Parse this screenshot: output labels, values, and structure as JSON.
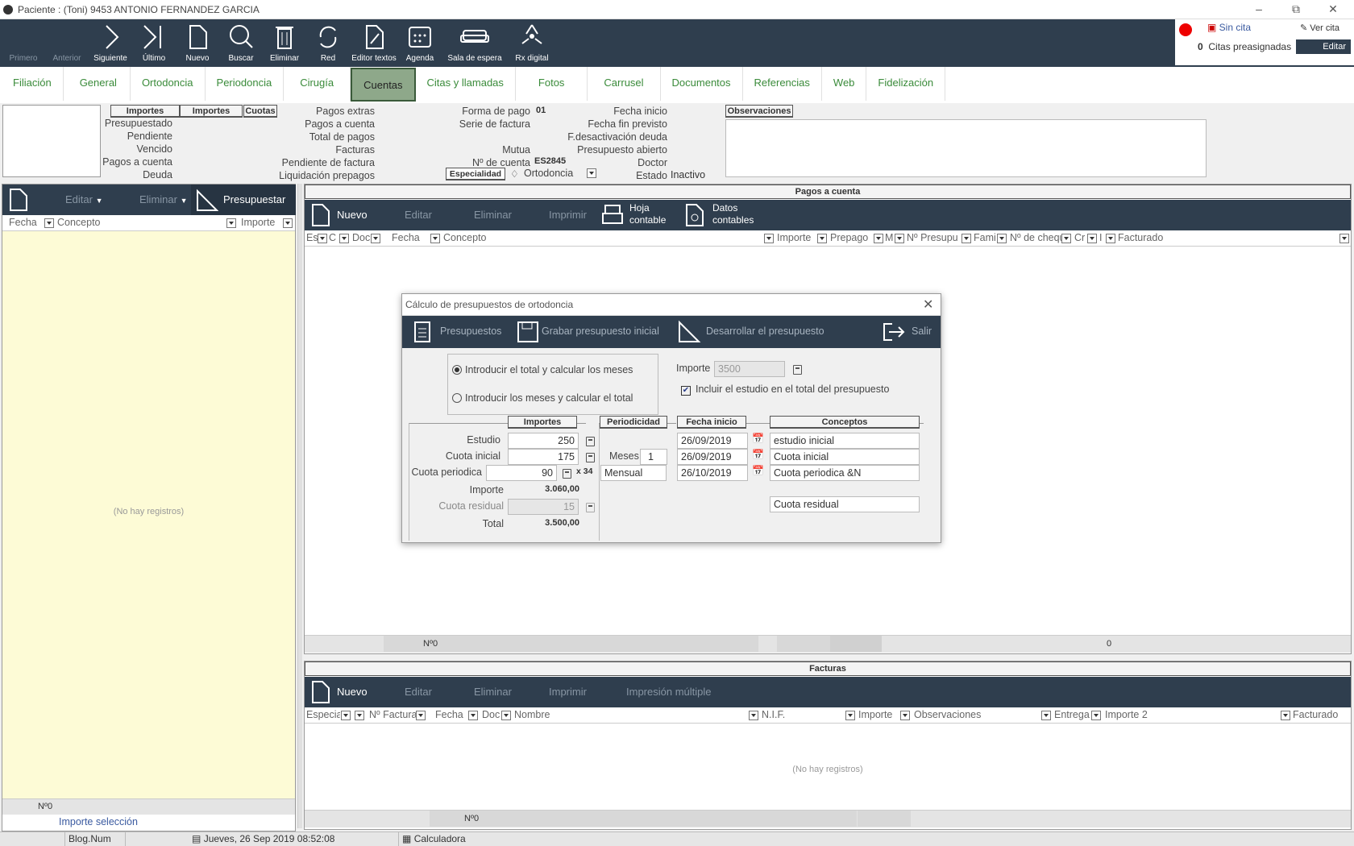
{
  "window": {
    "title": "Paciente :  (Toni)  9453 ANTONIO FERNANDEZ GARCIA"
  },
  "toolbar": [
    {
      "label": "Primero",
      "icon": "first-icon",
      "enabled": false
    },
    {
      "label": "Anterior",
      "icon": "previous-icon",
      "enabled": false
    },
    {
      "label": "Siguiente",
      "icon": "next-icon",
      "enabled": true
    },
    {
      "label": "Último",
      "icon": "last-icon",
      "enabled": true
    },
    {
      "label": "Nuevo",
      "icon": "new-document-icon",
      "enabled": true
    },
    {
      "label": "Buscar",
      "icon": "search-icon",
      "enabled": true
    },
    {
      "label": "Eliminar",
      "icon": "trash-icon",
      "enabled": true
    },
    {
      "label": "Red",
      "icon": "refresh-icon",
      "enabled": true
    },
    {
      "label": "Editor textos",
      "icon": "text-editor-icon",
      "enabled": true
    },
    {
      "label": "Agenda",
      "icon": "calendar-icon",
      "enabled": true
    },
    {
      "label": "Sala de espera",
      "icon": "sofa-icon",
      "enabled": true
    },
    {
      "label": "Rx digital",
      "icon": "radiation-icon",
      "enabled": true
    }
  ],
  "appointment": {
    "sin_cita": "Sin cita",
    "ver_cita": "Ver cita",
    "citas_count": "0",
    "citas_label": "Citas preasignadas",
    "editar": "Editar"
  },
  "tabs": [
    "Filiación",
    "General",
    "Ortodoncia",
    "Periodoncia",
    "Cirugía",
    "Cuentas",
    "Citas y llamadas",
    "Fotos",
    "Carrusel",
    "Documentos",
    "Referencias",
    "Web",
    "Fidelización"
  ],
  "active_tab": "Cuentas",
  "summary": {
    "headers": [
      "Importes",
      "Importes",
      "Cuotas"
    ],
    "rows": [
      "Presupuestado",
      "Pendiente",
      "Vencido",
      "Pagos a cuenta",
      "Deuda"
    ],
    "col2": [
      "Pagos extras",
      "Pagos a cuenta",
      "Total de pagos",
      "Facturas",
      "Pendiente de factura",
      "Liquidación prepagos"
    ],
    "col3_labels": [
      "Forma de pago",
      "Serie de factura",
      "",
      "Mutua",
      "Nº de cuenta"
    ],
    "forma_pago": "01",
    "cuenta": "ES2845",
    "especialidad_label": "Especialidad",
    "especialidad": "Ortodoncia",
    "col4": [
      "Fecha inicio",
      "Fecha fin previsto",
      "F.desactivación deuda",
      "Presupuesto abierto",
      "Doctor",
      "Estado"
    ],
    "estado": "Inactivo",
    "observaciones": "Observaciones"
  },
  "left_panel": {
    "editar": "Editar",
    "eliminar": "Eliminar",
    "presupuestar": "Presupuestar",
    "columns": [
      "Fecha",
      "Concepto",
      "Importe"
    ],
    "empty": "(No hay registros)",
    "count": "Nº0",
    "importe_seleccion": "Importe selección"
  },
  "pagos": {
    "title": "Pagos a cuenta",
    "actions": [
      "Nuevo",
      "Editar",
      "Eliminar",
      "Imprimir"
    ],
    "hoja": [
      "Hoja",
      "contable"
    ],
    "datos": [
      "Datos",
      "contables"
    ],
    "columns": [
      "Es",
      "C",
      "Doc",
      "Fecha",
      "Concepto",
      "Importe",
      "Prepago",
      "M",
      "Nº Presupu",
      "Fami",
      "Nº de cheque",
      "Cr",
      "I",
      "Facturado"
    ],
    "count": "Nº0",
    "total": "0"
  },
  "facturas": {
    "title": "Facturas",
    "actions": [
      "Nuevo",
      "Editar",
      "Eliminar",
      "Imprimir",
      "Impresión múltiple"
    ],
    "columns": [
      "Especia",
      "Nº Factura",
      "Fecha",
      "Doc",
      "Nombre",
      "N.I.F.",
      "Importe",
      "Observaciones",
      "Entrega",
      "Importe 2",
      "Facturado"
    ],
    "empty": "(No hay registros)",
    "count": "Nº0"
  },
  "dialog": {
    "title": "Cálculo de presupuestos de ortodoncia",
    "toolbar": [
      "Presupuestos",
      "Grabar presupuesto inicial",
      "Desarrollar el presupuesto",
      "Salir"
    ],
    "radio1": "Introducir el total y calcular los meses",
    "radio2": "Introducir los meses y calcular el total",
    "importe_label": "Importe",
    "importe_value": "3500",
    "incluir": "Incluir el estudio en el total del presupuesto",
    "headers": [
      "Importes",
      "Periodicidad",
      "Fecha inicio",
      "Conceptos"
    ],
    "estudio_label": "Estudio",
    "estudio": "250",
    "cuota_inicial_label": "Cuota inicial",
    "cuota_inicial": "175",
    "cuota_periodica_label": "Cuota periodica",
    "cuota_periodica": "90",
    "multiplier": "x 34",
    "importe2_label": "Importe",
    "importe2": "3.060,00",
    "cuota_residual_label": "Cuota residual",
    "cuota_residual": "15",
    "total_label": "Total",
    "total": "3.500,00",
    "meses_label": "Meses",
    "meses": "1",
    "periodicidad": "Mensual",
    "fechas": [
      "26/09/2019",
      "26/09/2019",
      "26/10/2019"
    ],
    "conceptos": [
      "estudio inicial",
      "Cuota inicial",
      "Cuota periodica &N",
      "Cuota residual"
    ]
  },
  "statusbar": {
    "blog": "Blog.Num",
    "date": "Jueves, 26 Sep 2019 08:52:08",
    "calc": "Calculadora"
  }
}
